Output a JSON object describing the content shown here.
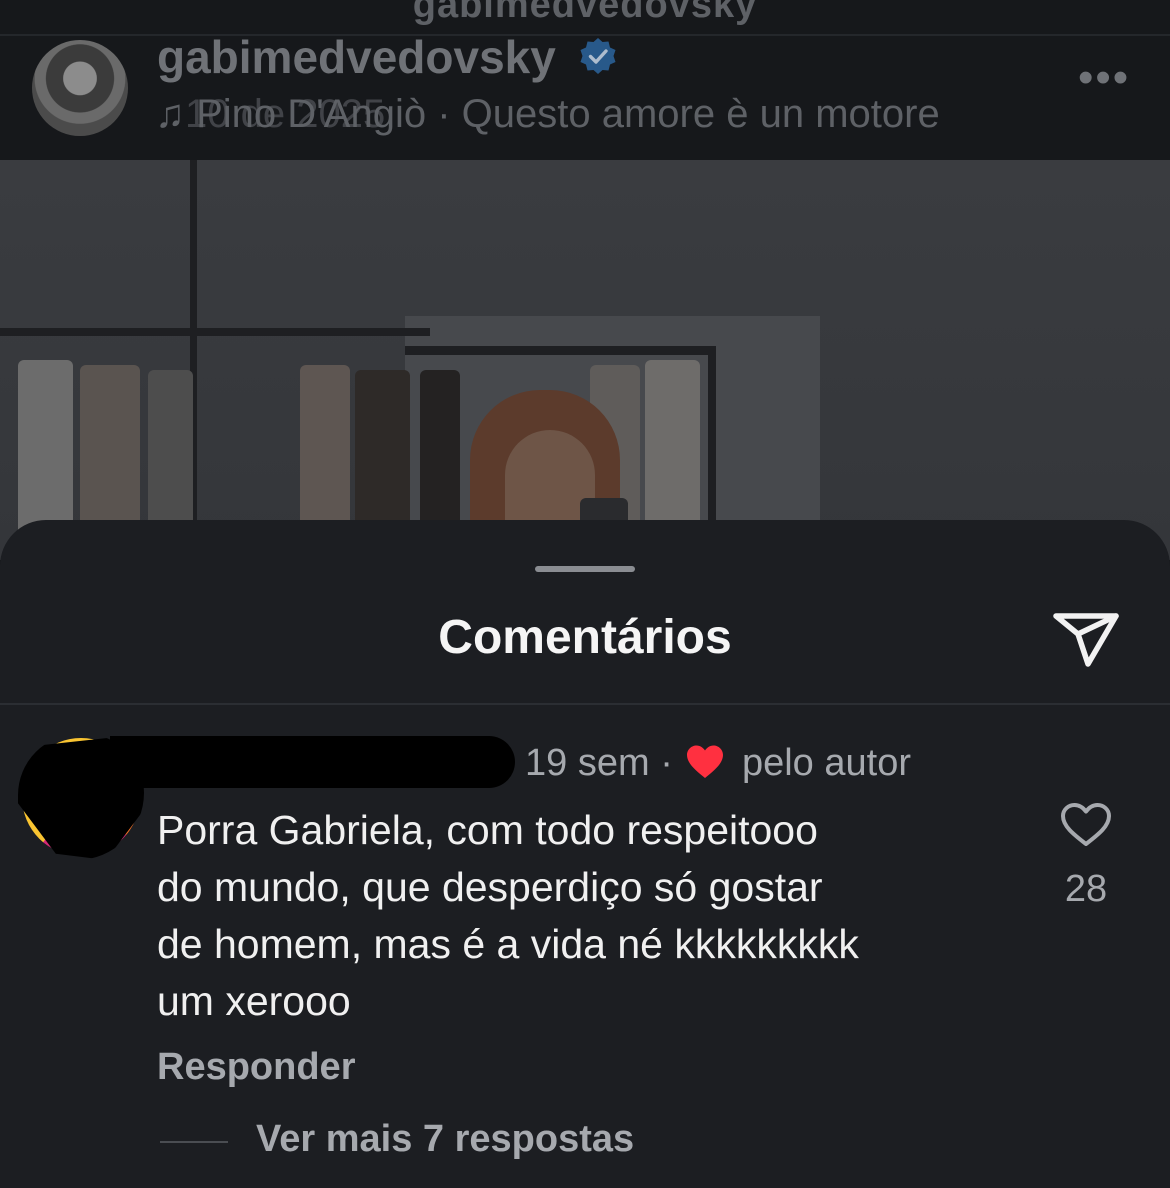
{
  "post": {
    "top_username": "gabimedvedovsky",
    "username": "gabimedvedovsky",
    "music_line": "♫ Pino D'Angiò · Questo amore è un motore",
    "music_overlay": "10 de 2025",
    "more_icon": "more-dots-icon"
  },
  "comments_sheet": {
    "title": "Comentários",
    "share_icon": "send-icon"
  },
  "comment": {
    "time": "19 sem",
    "separator": "·",
    "liked_by_author": "pelo autor",
    "text_lines": [
      "Porra Gabriela, com todo respeitooo",
      "do mundo, que desperdiço só gostar",
      "de homem, mas é a vida né kkkkkkkkk",
      "um xerooo"
    ],
    "like_count": "28",
    "reply_label": "Responder",
    "more_replies_label": "Ver mais 7 respostas"
  },
  "colors": {
    "sheet_bg": "#1c1e22",
    "heart_red": "#ff3040",
    "verified_blue": "#3797f0"
  }
}
